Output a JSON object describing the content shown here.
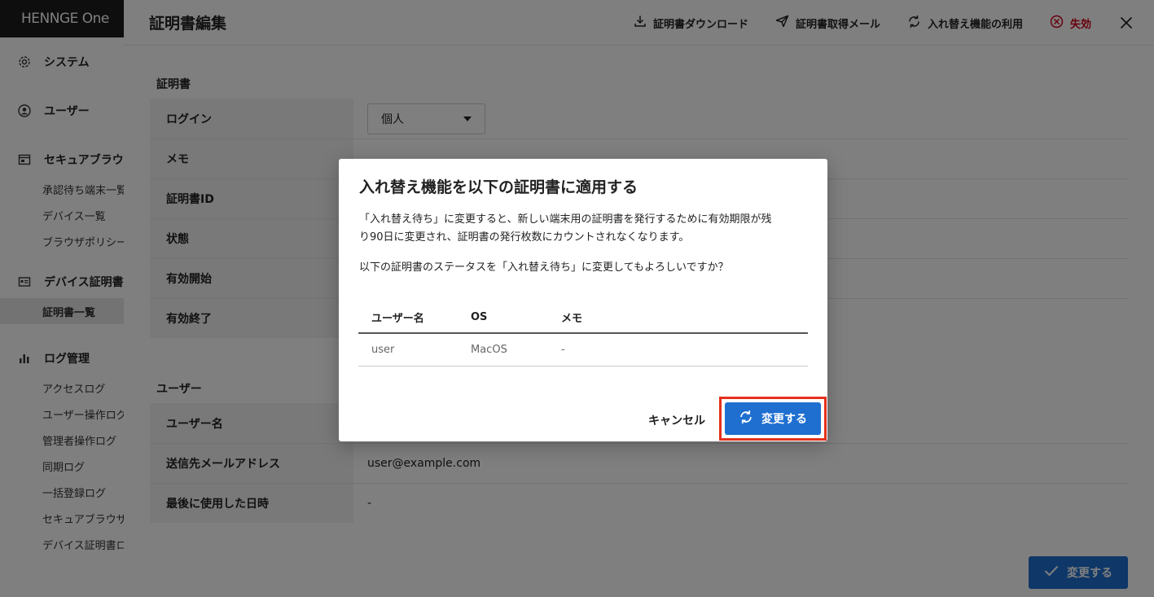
{
  "app": {
    "brand": "HENNGE One"
  },
  "sidebar": {
    "sections": [
      {
        "label": "システム",
        "icon": "gear-icon"
      },
      {
        "label": "ユーザー",
        "icon": "user-icon"
      },
      {
        "label": "セキュアブラウザ",
        "icon": "browser-icon",
        "items": [
          "承認待ち端末一覧",
          "デバイス一覧",
          "ブラウザポリシー"
        ]
      },
      {
        "label": "デバイス証明書",
        "icon": "id-card-icon",
        "items": [
          "証明書一覧"
        ]
      },
      {
        "label": "ログ管理",
        "icon": "bar-chart-icon",
        "items": [
          "アクセスログ",
          "ユーザー操作ログ",
          "管理者操作ログ",
          "同期ログ",
          "一括登録ログ",
          "セキュアブラウザログ",
          "デバイス証明書ログ"
        ]
      }
    ],
    "active_item": "証明書一覧"
  },
  "panel": {
    "title": "証明書編集",
    "actions": {
      "download": "証明書ダウンロード",
      "mail": "証明書取得メール",
      "replace": "入れ替え機能の利用",
      "revoke": "失効"
    },
    "cert_section": {
      "title": "証明書",
      "rows": [
        {
          "key": "ログイン",
          "value": ""
        },
        {
          "key": "メモ",
          "value": ""
        },
        {
          "key": "証明書ID",
          "value": ""
        },
        {
          "key": "状態",
          "value": ""
        },
        {
          "key": "有効開始",
          "value": ""
        },
        {
          "key": "有効終了",
          "value": ""
        }
      ],
      "login_select": "個人"
    },
    "user_section": {
      "title": "ユーザー",
      "rows": [
        {
          "key": "ユーザー名",
          "value": ""
        },
        {
          "key": "送信先メールアドレス",
          "value": "user@example.com"
        },
        {
          "key": "最後に使用した日時",
          "value": "-"
        }
      ]
    },
    "submit_label": "変更する"
  },
  "modal": {
    "title": "入れ替え機能を以下の証明書に適用する",
    "description_line1": "「入れ替え待ち」に変更すると、新しい端末用の証明書を発行するために有効期限が残",
    "description_line2": "り90日に変更され、証明書の発行枚数にカウントされなくなります。",
    "confirm": "以下の証明書のステータスを「入れ替え待ち」に変更してもよろしいですか？",
    "table": {
      "headers": [
        "ユーザー名",
        "OS",
        "メモ"
      ],
      "rows": [
        [
          "user",
          "MacOS",
          "-"
        ]
      ]
    },
    "cancel_label": "キャンセル",
    "confirm_label": "変更する",
    "highlight_color": "#e5301b",
    "primary_color": "#1f6fd1"
  }
}
